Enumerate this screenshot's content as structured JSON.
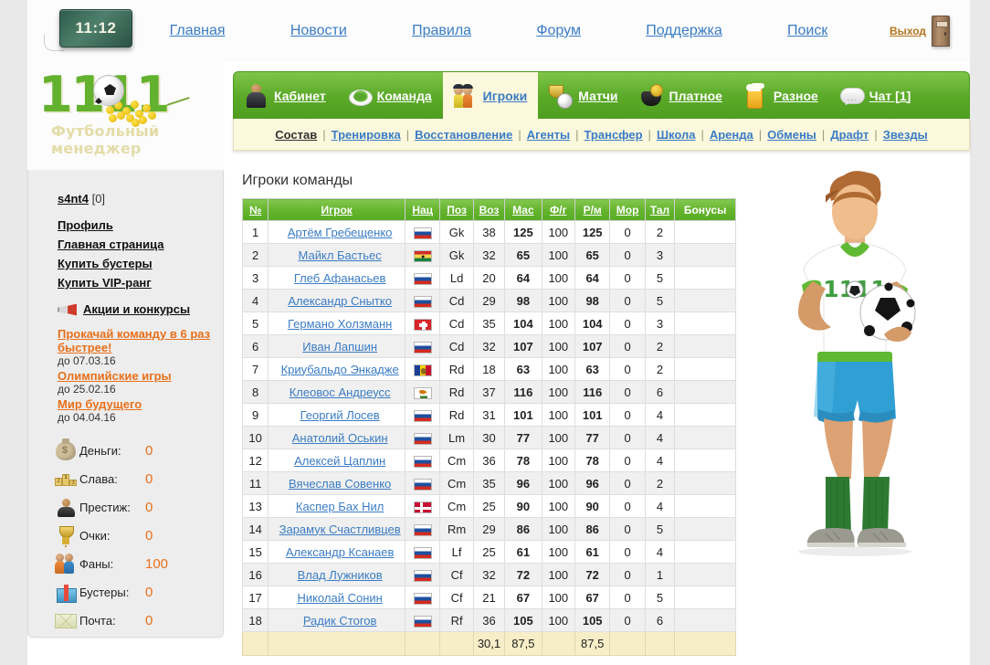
{
  "header": {
    "clock": "11:12",
    "nav": [
      {
        "label": "Главная"
      },
      {
        "label": "Новости"
      },
      {
        "label": "Правила"
      },
      {
        "label": "Форум"
      },
      {
        "label": "Поддержка"
      },
      {
        "label": "Поиск"
      }
    ],
    "exit_label": "Выход"
  },
  "logo": {
    "digits_left": "11",
    "digits_right": "11",
    "subtitle": "Футбольный менеджер"
  },
  "sidebar": {
    "user_name": "s4nt4",
    "user_badge": "[0]",
    "links": [
      {
        "label": "Профиль"
      },
      {
        "label": "Главная страница"
      },
      {
        "label": "Купить бустеры"
      },
      {
        "label": "Купить VIP-ранг"
      }
    ],
    "promo_section_label": "Акции и конкурсы",
    "promos": [
      {
        "label": "Прокачай команду в 6 раз быстрее!",
        "date": "до 07.03.16"
      },
      {
        "label": "Олимпийские игры",
        "date": "до 25.02.16"
      },
      {
        "label": "Мир будущего",
        "date": "до 04.04.16"
      }
    ],
    "stats": [
      {
        "icon": "money-bag-icon",
        "label": "Деньги:",
        "value": "0"
      },
      {
        "icon": "podium-icon",
        "label": "Слава:",
        "value": "0"
      },
      {
        "icon": "person-suit-icon",
        "label": "Престиж:",
        "value": "0"
      },
      {
        "icon": "trophy-icon",
        "label": "Очки:",
        "value": "0"
      },
      {
        "icon": "fans-icon",
        "label": "Фаны:",
        "value": "100"
      },
      {
        "icon": "gift-icon",
        "label": "Бустеры:",
        "value": "0"
      },
      {
        "icon": "mail-icon",
        "label": "Почта:",
        "value": "0"
      }
    ]
  },
  "tabs": [
    {
      "label": "Кабинет",
      "icon": "manager-icon",
      "active": false
    },
    {
      "label": "Команда",
      "icon": "stadium-icon",
      "active": false
    },
    {
      "label": "Игроки",
      "icon": "players-icon",
      "active": true
    },
    {
      "label": "Матчи",
      "icon": "trophy-ball-icon",
      "active": false
    },
    {
      "label": "Платное",
      "icon": "money-pot-icon",
      "active": false
    },
    {
      "label": "Разное",
      "icon": "beer-mug-icon",
      "active": false
    },
    {
      "label": "Чат [1]",
      "icon": "chat-bubble-icon",
      "active": false
    }
  ],
  "subnav": [
    {
      "label": "Состав",
      "current": true
    },
    {
      "label": "Тренировка",
      "current": false
    },
    {
      "label": "Восстановление",
      "current": false
    },
    {
      "label": "Агенты",
      "current": false
    },
    {
      "label": "Трансфер",
      "current": false
    },
    {
      "label": "Школа",
      "current": false
    },
    {
      "label": "Аренда",
      "current": false
    },
    {
      "label": "Обмены",
      "current": false
    },
    {
      "label": "Драфт",
      "current": false
    },
    {
      "label": "Звезды",
      "current": false
    }
  ],
  "panel": {
    "title": "Игроки команды",
    "columns": [
      {
        "key": "num",
        "label": "№",
        "sortable": true
      },
      {
        "key": "name",
        "label": "Игрок",
        "sortable": true
      },
      {
        "key": "nat",
        "label": "Нац",
        "sortable": true
      },
      {
        "key": "pos",
        "label": "Поз",
        "sortable": true
      },
      {
        "key": "age",
        "label": "Воз",
        "sortable": true
      },
      {
        "key": "mas",
        "label": "Мас",
        "sortable": true
      },
      {
        "key": "fg",
        "label": "Ф/г",
        "sortable": true
      },
      {
        "key": "rm",
        "label": "Р/м",
        "sortable": true
      },
      {
        "key": "mor",
        "label": "Мор",
        "sortable": true
      },
      {
        "key": "tal",
        "label": "Тал",
        "sortable": true
      },
      {
        "key": "bon",
        "label": "Бонусы",
        "sortable": false
      }
    ],
    "rows": [
      {
        "num": "1",
        "name": "Артём Гребещенко",
        "nat": "ru",
        "pos": "Gk",
        "age": "38",
        "mas": "125",
        "fg": "100",
        "rm": "125",
        "mor": "0",
        "tal": "2",
        "bon": ""
      },
      {
        "num": "2",
        "name": "Майкл Бастьес",
        "nat": "gh",
        "pos": "Gk",
        "age": "32",
        "mas": "65",
        "fg": "100",
        "rm": "65",
        "mor": "0",
        "tal": "3",
        "bon": ""
      },
      {
        "num": "3",
        "name": "Глеб Афанасьев",
        "nat": "ru",
        "pos": "Ld",
        "age": "20",
        "mas": "64",
        "fg": "100",
        "rm": "64",
        "mor": "0",
        "tal": "5",
        "bon": ""
      },
      {
        "num": "4",
        "name": "Александр Снытко",
        "nat": "ru",
        "pos": "Cd",
        "age": "29",
        "mas": "98",
        "fg": "100",
        "rm": "98",
        "mor": "0",
        "tal": "5",
        "bon": ""
      },
      {
        "num": "5",
        "name": "Германо Холзманн",
        "nat": "ch",
        "pos": "Cd",
        "age": "35",
        "mas": "104",
        "fg": "100",
        "rm": "104",
        "mor": "0",
        "tal": "3",
        "bon": ""
      },
      {
        "num": "6",
        "name": "Иван Лапшин",
        "nat": "ru",
        "pos": "Cd",
        "age": "32",
        "mas": "107",
        "fg": "100",
        "rm": "107",
        "mor": "0",
        "tal": "2",
        "bon": ""
      },
      {
        "num": "7",
        "name": "Криубальдо Энкадже",
        "nat": "md",
        "pos": "Rd",
        "age": "18",
        "mas": "63",
        "fg": "100",
        "rm": "63",
        "mor": "0",
        "tal": "2",
        "bon": ""
      },
      {
        "num": "8",
        "name": "Клеовос Андреусс",
        "nat": "cy",
        "pos": "Rd",
        "age": "37",
        "mas": "116",
        "fg": "100",
        "rm": "116",
        "mor": "0",
        "tal": "6",
        "bon": ""
      },
      {
        "num": "9",
        "name": "Георгий Лосев",
        "nat": "ru",
        "pos": "Rd",
        "age": "31",
        "mas": "101",
        "fg": "100",
        "rm": "101",
        "mor": "0",
        "tal": "4",
        "bon": ""
      },
      {
        "num": "10",
        "name": "Анатолий Оськин",
        "nat": "ru",
        "pos": "Lm",
        "age": "30",
        "mas": "77",
        "fg": "100",
        "rm": "77",
        "mor": "0",
        "tal": "4",
        "bon": ""
      },
      {
        "num": "12",
        "name": "Алексей Цаплин",
        "nat": "ru",
        "pos": "Cm",
        "age": "36",
        "mas": "78",
        "fg": "100",
        "rm": "78",
        "mor": "0",
        "tal": "4",
        "bon": ""
      },
      {
        "num": "11",
        "name": "Вячеслав Совенко",
        "nat": "ru",
        "pos": "Cm",
        "age": "35",
        "mas": "96",
        "fg": "100",
        "rm": "96",
        "mor": "0",
        "tal": "2",
        "bon": ""
      },
      {
        "num": "13",
        "name": "Каспер Бах Нил",
        "nat": "dk",
        "pos": "Cm",
        "age": "25",
        "mas": "90",
        "fg": "100",
        "rm": "90",
        "mor": "0",
        "tal": "4",
        "bon": ""
      },
      {
        "num": "14",
        "name": "Зарамук Счастливцев",
        "nat": "ru",
        "pos": "Rm",
        "age": "29",
        "mas": "86",
        "fg": "100",
        "rm": "86",
        "mor": "0",
        "tal": "5",
        "bon": ""
      },
      {
        "num": "15",
        "name": "Александр Ксанаев",
        "nat": "ru",
        "pos": "Lf",
        "age": "25",
        "mas": "61",
        "fg": "100",
        "rm": "61",
        "mor": "0",
        "tal": "4",
        "bon": ""
      },
      {
        "num": "16",
        "name": "Влад Лужников",
        "nat": "ru",
        "pos": "Cf",
        "age": "32",
        "mas": "72",
        "fg": "100",
        "rm": "72",
        "mor": "0",
        "tal": "1",
        "bon": ""
      },
      {
        "num": "17",
        "name": "Николай Сонин",
        "nat": "ru",
        "pos": "Cf",
        "age": "21",
        "mas": "67",
        "fg": "100",
        "rm": "67",
        "mor": "0",
        "tal": "5",
        "bon": ""
      },
      {
        "num": "18",
        "name": "Радик Стогов",
        "nat": "ru",
        "pos": "Rf",
        "age": "36",
        "mas": "105",
        "fg": "100",
        "rm": "105",
        "mor": "0",
        "tal": "6",
        "bon": ""
      }
    ],
    "totals": {
      "num": "",
      "name": "",
      "nat": "",
      "pos": "",
      "age": "30,1",
      "mas": "87,5",
      "fg": "",
      "rm": "87,5",
      "mor": "",
      "tal": "",
      "bon": ""
    }
  },
  "illustration": {
    "jersey_text": "11 11",
    "name": "football-player-illustration"
  },
  "colors": {
    "green": "#5aa927",
    "link_blue": "#3a7cc4",
    "orange": "#e8701a",
    "cream": "#fcf8dd",
    "value_green": "#2d7d15"
  }
}
